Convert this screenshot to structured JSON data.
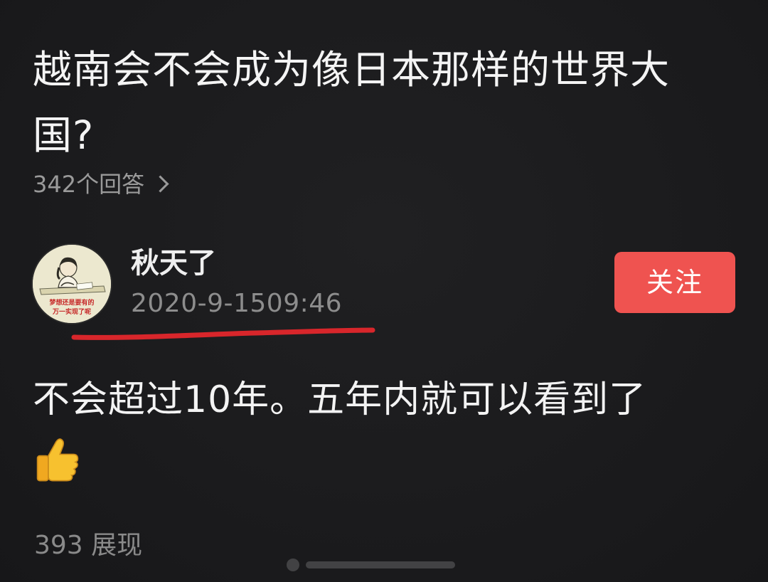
{
  "question": {
    "title": "越南会不会成为像日本那样的世界大国?",
    "answer_count": "342个回答"
  },
  "author": {
    "name": "秋天了",
    "time": "2020-9-1509:46",
    "avatar_caption_line1": "梦想还是要有的",
    "avatar_caption_line2": "万一实现了呢"
  },
  "follow_button": {
    "label": "关注",
    "color": "#ef5350"
  },
  "answer": {
    "text": "不会超过10年。五年内就可以看到了",
    "emoji": "👍"
  },
  "stats": {
    "views": "393 展现"
  },
  "colors": {
    "background": "#1b1b1d",
    "primary_text": "#f3f3f3",
    "secondary_text": "#8d8d8d",
    "underline": "#d8262b"
  }
}
